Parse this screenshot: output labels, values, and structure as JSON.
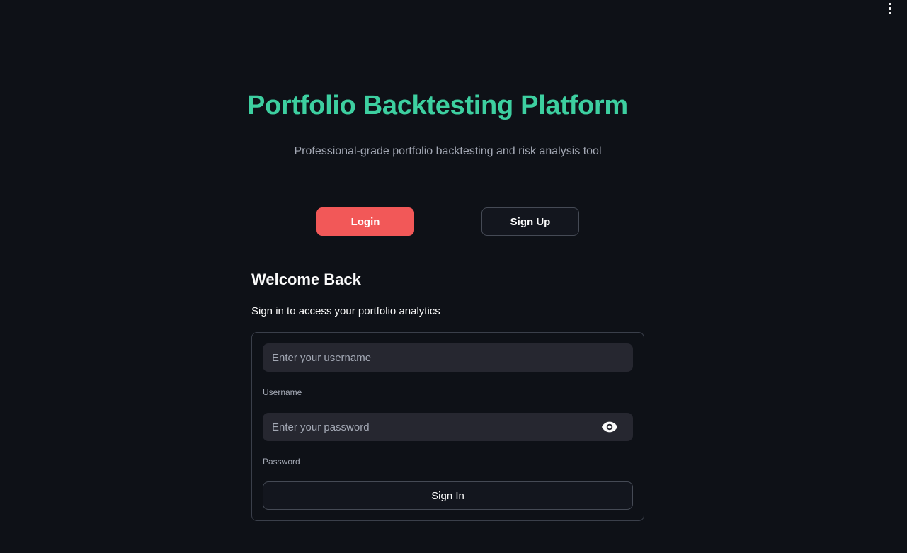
{
  "header": {
    "title": "Portfolio Backtesting Platform",
    "subtitle": "Professional-grade portfolio backtesting and risk analysis tool",
    "menu_icon": "more-vertical-icon"
  },
  "tabs": {
    "login_label": "Login",
    "signup_label": "Sign Up",
    "active": "Login"
  },
  "login_form": {
    "heading": "Welcome Back",
    "description": "Sign in to access your portfolio analytics",
    "username": {
      "placeholder": "Enter your username",
      "value": "",
      "label": "Username"
    },
    "password": {
      "placeholder": "Enter your password",
      "value": "",
      "label": "Password",
      "toggle_icon": "eye-icon"
    },
    "submit_label": "Sign In"
  },
  "colors": {
    "background": "#0e1117",
    "title": "#3dcfa0",
    "primary_button": "#f25858",
    "input_bg": "#262730"
  }
}
